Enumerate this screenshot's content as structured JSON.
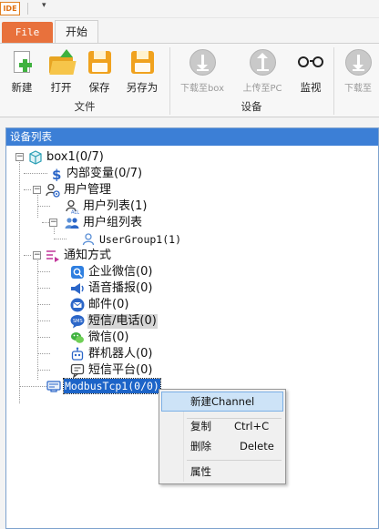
{
  "app": {
    "logo_text": "IDE",
    "qa_dropdown": "▾"
  },
  "tabs": {
    "file": "File",
    "home": "开始"
  },
  "ribbon": {
    "file_group": {
      "label": "文件",
      "new": "新建",
      "open": "打开",
      "save": "保存",
      "save_as": "另存为"
    },
    "device_group": {
      "label": "设备",
      "download_box": "下载至box",
      "upload_pc": "上传至PC",
      "monitor": "监视",
      "download_more": "下载至"
    }
  },
  "panel": {
    "title": "设备列表",
    "tree": {
      "box": "box1(0/7)",
      "internal_vars": "内部变量(0/7)",
      "user_mgmt": "用户管理",
      "user_list": "用户列表(1)",
      "usergroup_list": "用户组列表",
      "usergroup1": "UserGroup1(1)",
      "notify": "通知方式",
      "wecom": "企业微信(0)",
      "voice": "语音播报(0)",
      "mail": "邮件(0)",
      "sms_phone": "短信/电话(0)",
      "wechat": "微信(0)",
      "group_bot": "群机器人(0)",
      "sms_platform": "短信平台(0)",
      "modbus": "ModbusTcp1(0/0)"
    }
  },
  "context_menu": {
    "new_channel": "新建Channel",
    "copy": "复制",
    "copy_shortcut": "Ctrl+C",
    "delete": "删除",
    "delete_shortcut": "Delete",
    "properties": "属性"
  },
  "colors": {
    "accent_blue": "#3c7fd6",
    "file_tab": "#e8713c",
    "selection": "#1c64c8",
    "menu_highlight": "#cde3f7"
  }
}
